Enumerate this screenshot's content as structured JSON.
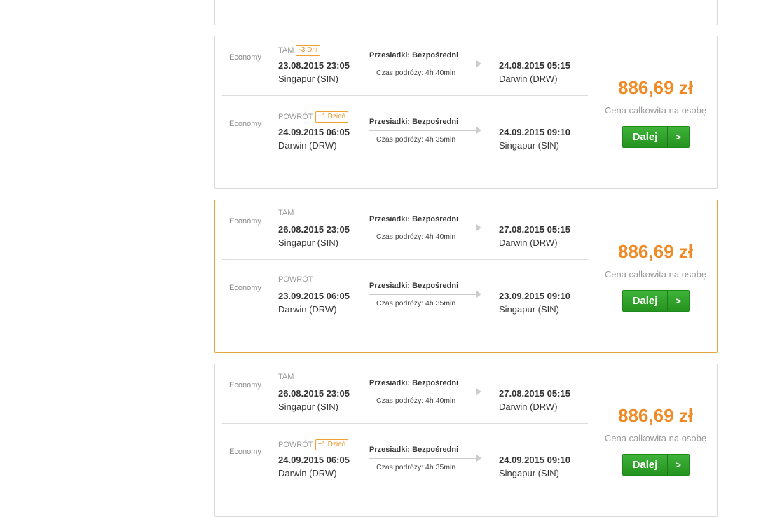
{
  "colors": {
    "price": "#f08a24",
    "button": "#2ea32a",
    "highlight_border": "#e0a83a"
  },
  "offers": [
    {
      "highlighted": false,
      "legs": [
        {
          "cabin": "Economy",
          "direction": "TAM",
          "badge": "-3 Dni",
          "stops_label": "Przesiadki:",
          "stops_value": "Bezpośredni",
          "duration": "Czas podróży: 4h 40min",
          "dep_datetime": "23.08.2015 23:05",
          "dep_city": "Singapur (SIN)",
          "arr_datetime": "24.08.2015 05:15",
          "arr_city": "Darwin (DRW)"
        },
        {
          "cabin": "Economy",
          "direction": "POWRÓT",
          "badge": "+1 Dzień",
          "stops_label": "Przesiadki:",
          "stops_value": "Bezpośredni",
          "duration": "Czas podróży: 4h 35min",
          "dep_datetime": "24.09.2015 06:05",
          "dep_city": "Darwin (DRW)",
          "arr_datetime": "24.09.2015 09:10",
          "arr_city": "Singapur (SIN)"
        }
      ],
      "price": "886,69 zł",
      "price_label": "Cena całkowita na osobę",
      "button_label": "Dalej",
      "button_arrow": ">"
    },
    {
      "highlighted": true,
      "legs": [
        {
          "cabin": "Economy",
          "direction": "TAM",
          "badge": "",
          "stops_label": "Przesiadki:",
          "stops_value": "Bezpośredni",
          "duration": "Czas podróży: 4h 40min",
          "dep_datetime": "26.08.2015 23:05",
          "dep_city": "Singapur (SIN)",
          "arr_datetime": "27.08.2015 05:15",
          "arr_city": "Darwin (DRW)"
        },
        {
          "cabin": "Economy",
          "direction": "POWRÓT",
          "badge": "",
          "stops_label": "Przesiadki:",
          "stops_value": "Bezpośredni",
          "duration": "Czas podróży: 4h 35min",
          "dep_datetime": "23.09.2015 06:05",
          "dep_city": "Darwin (DRW)",
          "arr_datetime": "23.09.2015 09:10",
          "arr_city": "Singapur (SIN)"
        }
      ],
      "price": "886,69 zł",
      "price_label": "Cena całkowita na osobę",
      "button_label": "Dalej",
      "button_arrow": ">"
    },
    {
      "highlighted": false,
      "legs": [
        {
          "cabin": "Economy",
          "direction": "TAM",
          "badge": "",
          "stops_label": "Przesiadki:",
          "stops_value": "Bezpośredni",
          "duration": "Czas podróży: 4h 40min",
          "dep_datetime": "26.08.2015 23:05",
          "dep_city": "Singapur (SIN)",
          "arr_datetime": "27.08.2015 05:15",
          "arr_city": "Darwin (DRW)"
        },
        {
          "cabin": "Economy",
          "direction": "POWRÓT",
          "badge": "+1 Dzień",
          "stops_label": "Przesiadki:",
          "stops_value": "Bezpośredni",
          "duration": "Czas podróży: 4h 35min",
          "dep_datetime": "24.09.2015 06:05",
          "dep_city": "Darwin (DRW)",
          "arr_datetime": "24.09.2015 09:10",
          "arr_city": "Singapur (SIN)"
        }
      ],
      "price": "886,69 zł",
      "price_label": "Cena całkowita na osobę",
      "button_label": "Dalej",
      "button_arrow": ">"
    }
  ]
}
